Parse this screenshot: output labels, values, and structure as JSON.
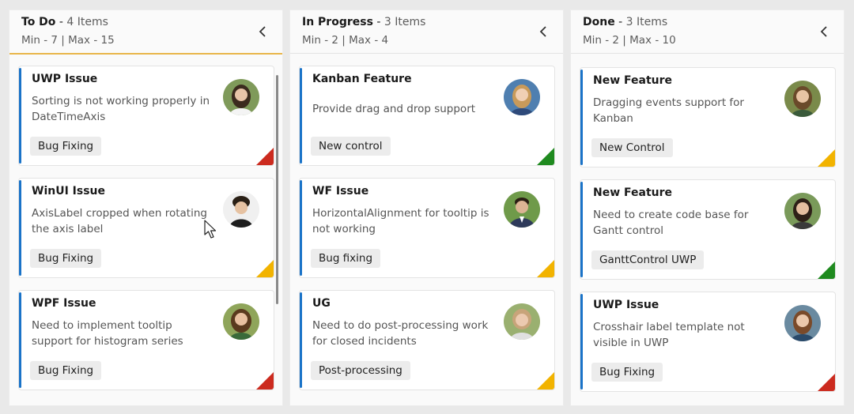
{
  "columns": [
    {
      "name": "To Do",
      "separator": " - ",
      "count": "4 Items",
      "limits": "Min - 7 | Max - 15",
      "cards": [
        {
          "title": "UWP Issue",
          "description": "Sorting is not working properly in DateTimeAxis",
          "tag": "Bug Fixing",
          "priority_color": "#cc2b1f",
          "avatar_icon": "woman-avatar-icon"
        },
        {
          "title": "WinUI Issue",
          "description": "AxisLabel cropped when rotating the axis label",
          "tag": "Bug Fixing",
          "priority_color": "#f2b300",
          "avatar_icon": "man-avatar-icon"
        },
        {
          "title": "WPF Issue",
          "description": "Need to implement tooltip support for histogram series",
          "tag": "Bug Fixing",
          "priority_color": "#cc2b1f",
          "avatar_icon": "woman-avatar-icon"
        }
      ]
    },
    {
      "name": "In Progress",
      "separator": " - ",
      "count": "3 Items",
      "limits": "Min - 2 | Max - 4",
      "cards": [
        {
          "title": "Kanban Feature",
          "description": "Provide drag and drop support",
          "tag": "New control",
          "priority_color": "#1f8a1f",
          "avatar_icon": "woman-avatar-icon"
        },
        {
          "title": "WF Issue",
          "description": "HorizontalAlignment for tooltip is not working",
          "tag": "Bug fixing",
          "priority_color": "#f2b300",
          "avatar_icon": "man-avatar-icon"
        },
        {
          "title": "UG",
          "description": "Need to do post-processing work for closed incidents",
          "tag": "Post-processing",
          "priority_color": "#f2b300",
          "avatar_icon": "woman-avatar-icon"
        }
      ]
    },
    {
      "name": "Done",
      "separator": " - ",
      "count": "3 Items",
      "limits": "Min - 2 | Max - 10",
      "cards": [
        {
          "title": "New Feature",
          "description": "Dragging events support for Kanban",
          "tag": "New Control",
          "priority_color": "#f2b300",
          "avatar_icon": "woman-avatar-icon"
        },
        {
          "title": "New Feature",
          "description": "Need to create code base for Gantt control",
          "tag": "GanttControl UWP",
          "priority_color": "#1f8a1f",
          "avatar_icon": "woman-avatar-icon"
        },
        {
          "title": "UWP Issue",
          "description": "Crosshair label template not visible in UWP",
          "tag": "Bug Fixing",
          "priority_color": "#cc2b1f",
          "avatar_icon": "woman-avatar-icon"
        }
      ]
    }
  ],
  "colors": {
    "accent_bar": "#1a73c8",
    "active_header_underline": "#e8b64a"
  },
  "icons": {
    "collapse": "chevron-left-icon",
    "cursor": "mouse-pointer-icon"
  }
}
